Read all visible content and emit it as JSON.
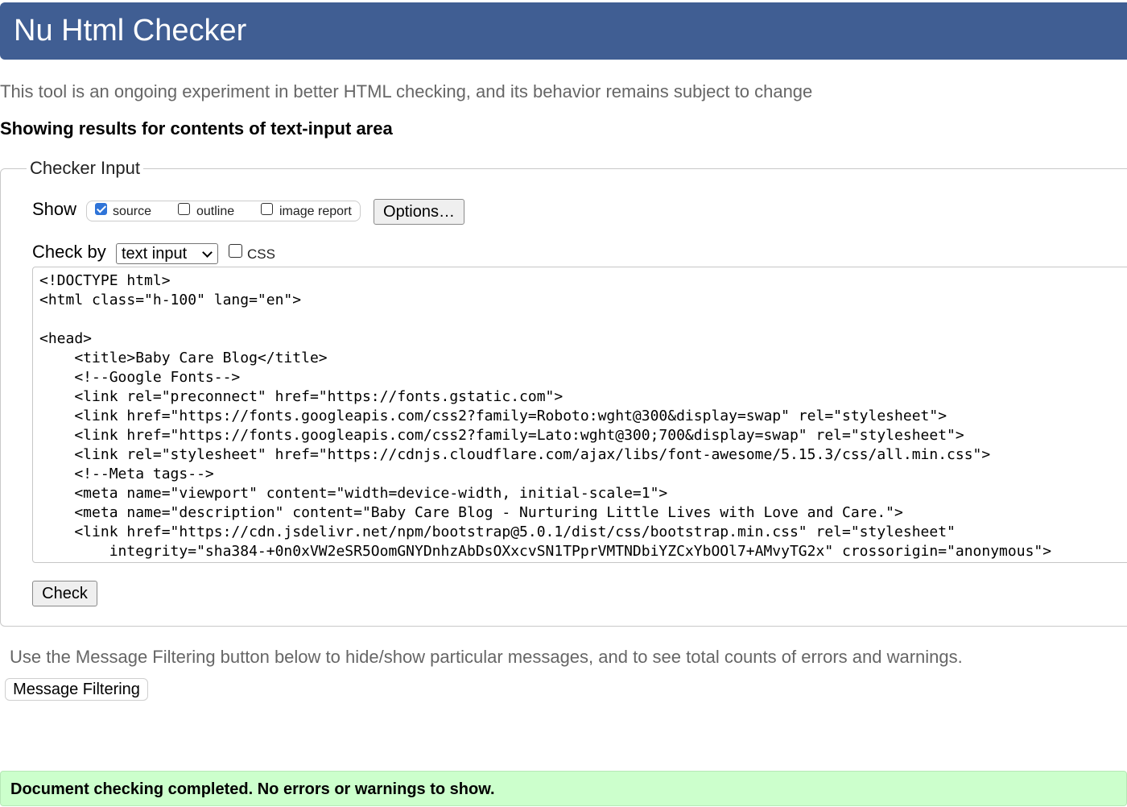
{
  "header": {
    "title": "Nu Html Checker"
  },
  "intro_text": "This tool is an ongoing experiment in better HTML checking, and its behavior remains subject to change",
  "results_heading": "Showing results for contents of text-input area",
  "checker_input": {
    "legend": "Checker Input",
    "show_label": "Show",
    "show_options": [
      {
        "label": "source",
        "checked": true
      },
      {
        "label": "outline",
        "checked": false
      },
      {
        "label": "image report",
        "checked": false
      }
    ],
    "options_button": "Options…",
    "check_by_label": "Check by",
    "check_by_selected": "text input",
    "css_option": {
      "label": "CSS",
      "checked": false
    },
    "source_text": "<!DOCTYPE html>\n<html class=\"h-100\" lang=\"en\">\n\n<head>\n    <title>Baby Care Blog</title>\n    <!--Google Fonts-->\n    <link rel=\"preconnect\" href=\"https://fonts.gstatic.com\">\n    <link href=\"https://fonts.googleapis.com/css2?family=Roboto:wght@300&display=swap\" rel=\"stylesheet\">\n    <link href=\"https://fonts.googleapis.com/css2?family=Lato:wght@300;700&display=swap\" rel=\"stylesheet\">\n    <link rel=\"stylesheet\" href=\"https://cdnjs.cloudflare.com/ajax/libs/font-awesome/5.15.3/css/all.min.css\">\n    <!--Meta tags-->\n    <meta name=\"viewport\" content=\"width=device-width, initial-scale=1\">\n    <meta name=\"description\" content=\"Baby Care Blog - Nurturing Little Lives with Love and Care.\">\n    <link href=\"https://cdn.jsdelivr.net/npm/bootstrap@5.0.1/dist/css/bootstrap.min.css\" rel=\"stylesheet\"\n        integrity=\"sha384-+0n0xVW2eSR5OomGNYDnhzAbDsOXxcvSN1TPprVMTNDbiYZCxYbOOl7+AMvyTG2x\" crossorigin=\"anonymous\">",
    "check_button": "Check"
  },
  "filter_note": "Use the Message Filtering button below to hide/show particular messages, and to see total counts of errors and warnings.",
  "filter_button": "Message Filtering",
  "success_message": "Document checking completed. No errors or warnings to show.",
  "colors": {
    "header_bg": "#405e93",
    "success_bg": "#ccffcc",
    "checkbox_checked": "#2f74d8"
  }
}
